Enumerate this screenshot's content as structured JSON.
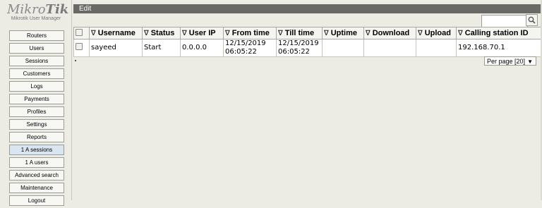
{
  "logo": {
    "brand_light": "Mikro",
    "brand_bold": "Tik",
    "subtitle": "Mikrotik User Manager"
  },
  "nav": {
    "items": [
      {
        "label": "Routers"
      },
      {
        "label": "Users"
      },
      {
        "label": "Sessions"
      },
      {
        "label": "Customers"
      },
      {
        "label": "Logs"
      },
      {
        "label": "Payments"
      },
      {
        "label": "Profiles"
      },
      {
        "label": "Settings"
      },
      {
        "label": "Reports"
      },
      {
        "label": "1 A sessions",
        "active": true
      },
      {
        "label": "1 A users"
      },
      {
        "label": "Advanced search"
      },
      {
        "label": "Maintenance"
      },
      {
        "label": "Logout"
      }
    ]
  },
  "header": {
    "title": "Edit"
  },
  "search": {
    "value": "",
    "icon": "magnifier-icon"
  },
  "table": {
    "sort_glyph": "∇",
    "columns": [
      "Username",
      "Status",
      "User IP",
      "From time",
      "Till time",
      "Uptime",
      "Download",
      "Upload",
      "Calling station ID"
    ],
    "rows": [
      {
        "username": "sayeed",
        "status": "Start",
        "user_ip": "0.0.0.0",
        "from_date": "12/15/2019",
        "from_time": "06:05:22",
        "till_date": "12/15/2019",
        "till_time": "06:05:22",
        "uptime": "",
        "download": "",
        "upload": "",
        "calling_station_id": "192.168.70.1"
      }
    ]
  },
  "pager": {
    "per_page_label": "Per page [20]",
    "arrow": "▼"
  },
  "colors": {
    "titlebar": "#696966",
    "background": "#ecebe4",
    "active_nav": "#d9e6f2"
  }
}
